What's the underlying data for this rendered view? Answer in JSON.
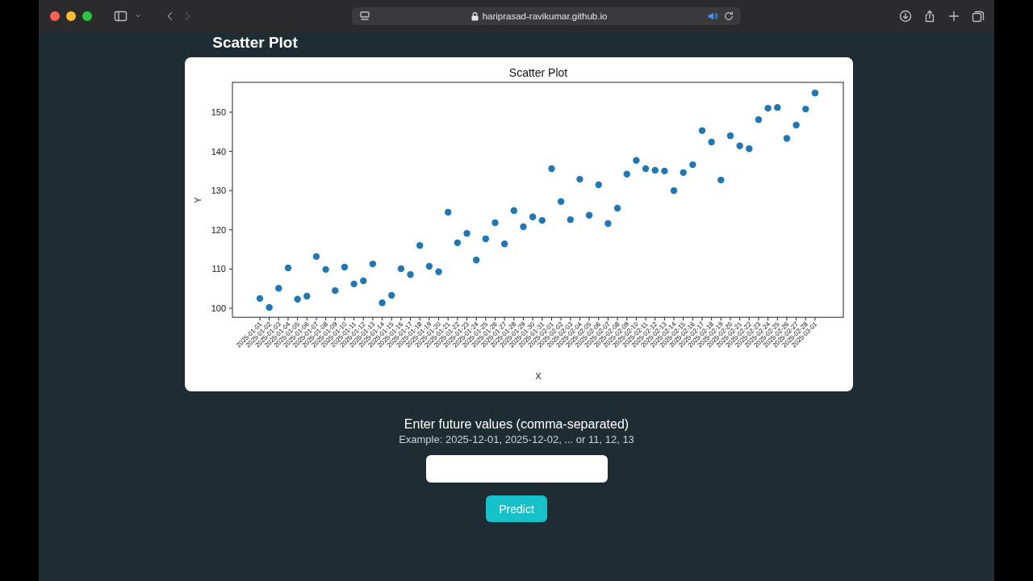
{
  "browser": {
    "url": "hariprasad-ravikumar.github.io",
    "forward_disabled": true
  },
  "heading": "Scatter Plot",
  "chart": {
    "chart_data": {
      "type": "scatter",
      "title": "Scatter Plot",
      "xlabel": "X",
      "ylabel": "Y",
      "categories": [
        "2025-01-01",
        "2025-01-02",
        "2025-01-03",
        "2025-01-04",
        "2025-01-05",
        "2025-01-06",
        "2025-01-07",
        "2025-01-08",
        "2025-01-09",
        "2025-01-10",
        "2025-01-11",
        "2025-01-12",
        "2025-01-13",
        "2025-01-14",
        "2025-01-15",
        "2025-01-16",
        "2025-01-17",
        "2025-01-18",
        "2025-01-19",
        "2025-01-20",
        "2025-01-21",
        "2025-01-22",
        "2025-01-23",
        "2025-01-24",
        "2025-01-25",
        "2025-01-26",
        "2025-01-27",
        "2025-01-28",
        "2025-01-29",
        "2025-01-30",
        "2025-01-31",
        "2025-02-01",
        "2025-02-02",
        "2025-02-03",
        "2025-02-04",
        "2025-02-05",
        "2025-02-06",
        "2025-02-07",
        "2025-02-08",
        "2025-02-09",
        "2025-02-10",
        "2025-02-11",
        "2025-02-12",
        "2025-02-13",
        "2025-02-14",
        "2025-02-15",
        "2025-02-16",
        "2025-02-17",
        "2025-02-18",
        "2025-02-19",
        "2025-02-20",
        "2025-02-21",
        "2025-02-22",
        "2025-02-23",
        "2025-02-24",
        "2025-02-25",
        "2025-02-26",
        "2025-02-27",
        "2025-02-28",
        "2025-03-01"
      ],
      "series": [
        {
          "color": "#1f77b4",
          "values": [
            102.5,
            100.2,
            105.1,
            110.3,
            102.3,
            103.1,
            113.2,
            109.9,
            104.5,
            110.5,
            106.2,
            107.0,
            111.3,
            101.4,
            103.3,
            110.1,
            108.6,
            116.0,
            110.7,
            109.3,
            124.5,
            116.7,
            119.1,
            112.3,
            117.7,
            121.8,
            116.4,
            124.9,
            120.8,
            123.3,
            122.4,
            135.6,
            127.2,
            122.6,
            132.9,
            123.7,
            131.5,
            121.6,
            125.5,
            134.2,
            137.7,
            135.6,
            135.2,
            135.0,
            130.0,
            134.6,
            136.6,
            145.3,
            142.4,
            132.7,
            144.0,
            141.4,
            140.7,
            148.1,
            151.0,
            151.2,
            143.3,
            146.7,
            150.8,
            154.9
          ]
        }
      ],
      "ylim": [
        97.7,
        157.6
      ],
      "yticks": [
        100,
        110,
        120,
        130,
        140,
        150
      ]
    }
  },
  "form": {
    "label": "Enter future values (comma-separated)",
    "hint": "Example: 2025-12-01, 2025-12-02, ... or 11, 12, 13",
    "button": "Predict"
  }
}
